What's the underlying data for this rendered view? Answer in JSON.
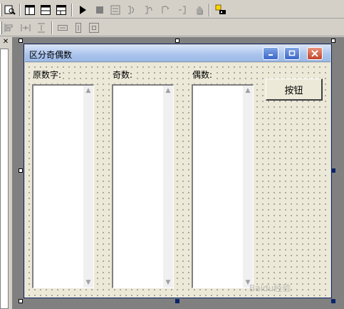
{
  "form": {
    "title": "区分奇偶数",
    "labels": {
      "original": "原数字:",
      "odd": "奇数:",
      "even": "偶数:"
    },
    "button_label": "按钮"
  },
  "toolbar1": {
    "icons": [
      "properties-icon",
      "layout-1-icon",
      "layout-2-icon",
      "layout-3-icon",
      "run-icon",
      "stop-icon",
      "step-icon",
      "step-into-icon",
      "step-over-icon",
      "step-out-icon",
      "run-to-cursor-icon",
      "hand-icon",
      "debug-icon"
    ]
  },
  "toolbar2": {
    "icons": [
      "align-left-icon",
      "space-horizontal-icon",
      "space-vertical-icon",
      "same-width-icon",
      "same-height-icon",
      "center-icon"
    ]
  },
  "watermark": "Baidu经验"
}
